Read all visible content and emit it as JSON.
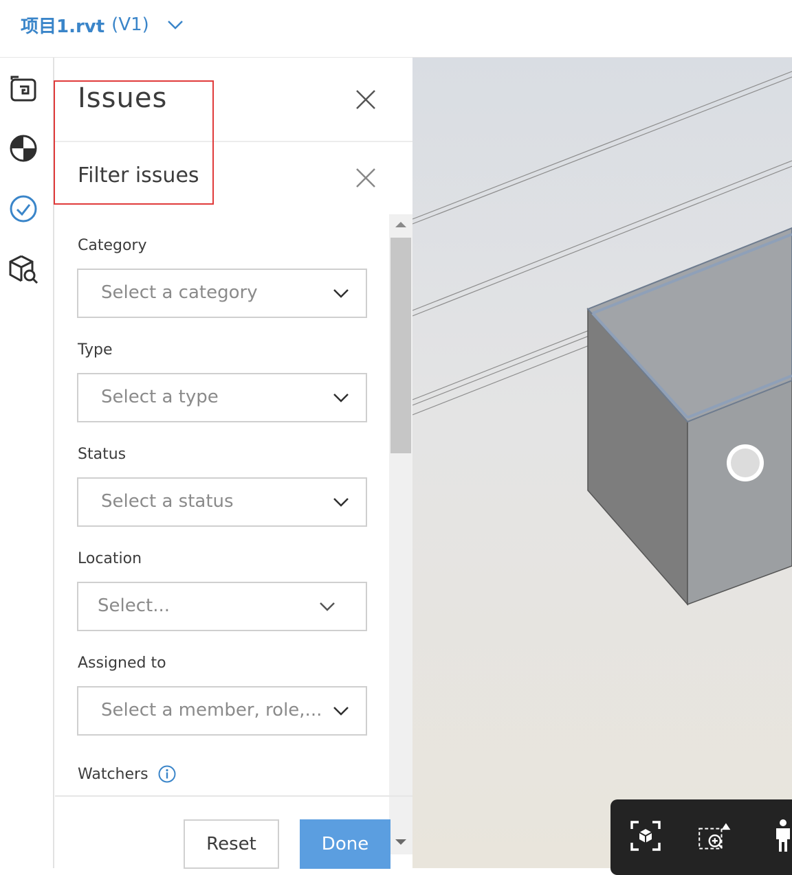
{
  "header": {
    "file_name": "项目1.rvt",
    "version": "(V1)",
    "chevron_icon": "chevron-down-icon"
  },
  "rail": {
    "items": [
      {
        "name": "sheets-icon"
      },
      {
        "name": "model-browser-icon"
      },
      {
        "name": "issues-check-icon"
      },
      {
        "name": "model-search-icon"
      }
    ]
  },
  "panel": {
    "title": "Issues",
    "subtitle": "Filter issues",
    "fields": {
      "category": {
        "label": "Category",
        "placeholder": "Select a category"
      },
      "type": {
        "label": "Type",
        "placeholder": "Select a type"
      },
      "status": {
        "label": "Status",
        "placeholder": "Select a status"
      },
      "location": {
        "label": "Location",
        "placeholder": "Select..."
      },
      "assigned_to": {
        "label": "Assigned to",
        "placeholder": "Select a member, role,..."
      },
      "watchers": {
        "label": "Watchers"
      }
    },
    "buttons": {
      "reset": "Reset",
      "done": "Done"
    }
  },
  "colors": {
    "accent": "#3a85c9",
    "done_button": "#5b9ee0",
    "highlight": "#e03a3a",
    "toolbar_bg": "#232323"
  }
}
